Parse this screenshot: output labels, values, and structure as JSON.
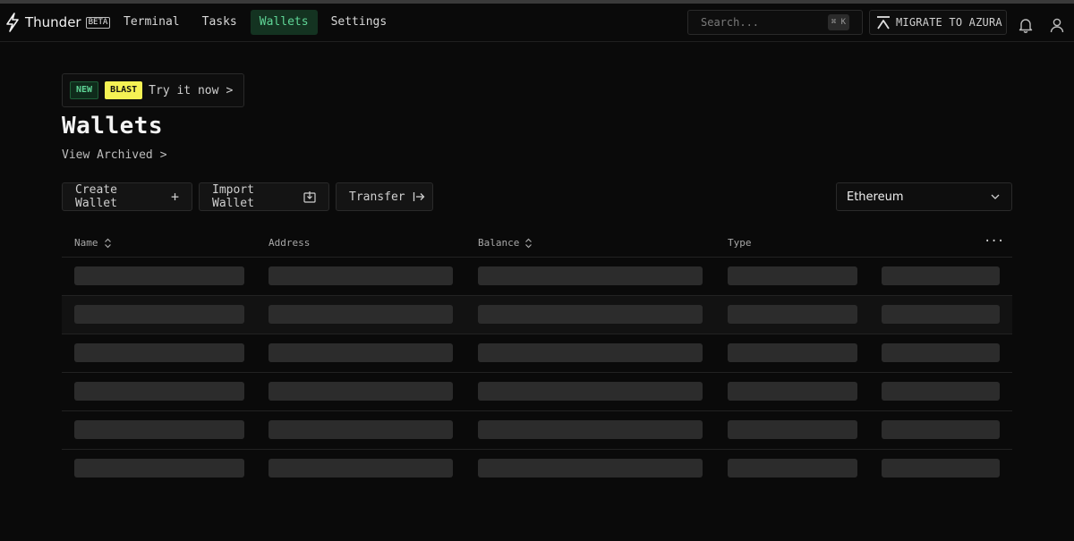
{
  "app": {
    "name": "Thunder",
    "badge": "BETA"
  },
  "nav": {
    "items": [
      {
        "label": "Terminal",
        "active": false
      },
      {
        "label": "Tasks",
        "active": false
      },
      {
        "label": "Wallets",
        "active": true
      },
      {
        "label": "Settings",
        "active": false
      }
    ]
  },
  "search": {
    "placeholder": "Search...",
    "shortcut": "⌘ K"
  },
  "migrate": {
    "label": "MIGRATE TO AZURA",
    "icon": "azura-logo-icon"
  },
  "header_icons": [
    "bell-icon",
    "user-icon"
  ],
  "promo": {
    "new_tag": "NEW",
    "blast_tag": "BLAST",
    "text": "Try it now",
    "chevron": ">"
  },
  "page": {
    "title": "Wallets",
    "archived_link": "View Archived",
    "archived_chevron": ">"
  },
  "actions": {
    "create": {
      "label": "Create Wallet",
      "icon": "+"
    },
    "import": {
      "label": "Import Wallet",
      "icon": "import-icon"
    },
    "transfer": {
      "label": "Transfer",
      "icon": "transfer-icon"
    }
  },
  "network_select": {
    "value": "Ethereum"
  },
  "table": {
    "columns": [
      "Name",
      "Address",
      "Balance",
      "Type"
    ],
    "more": "···",
    "rows_loading": 6
  },
  "colors": {
    "background": "#0a0a0a",
    "accent_green": "#5fd596",
    "active_nav_bg": "#143321",
    "blast_yellow": "#f5f254",
    "skeleton": "#2c2c2c"
  }
}
